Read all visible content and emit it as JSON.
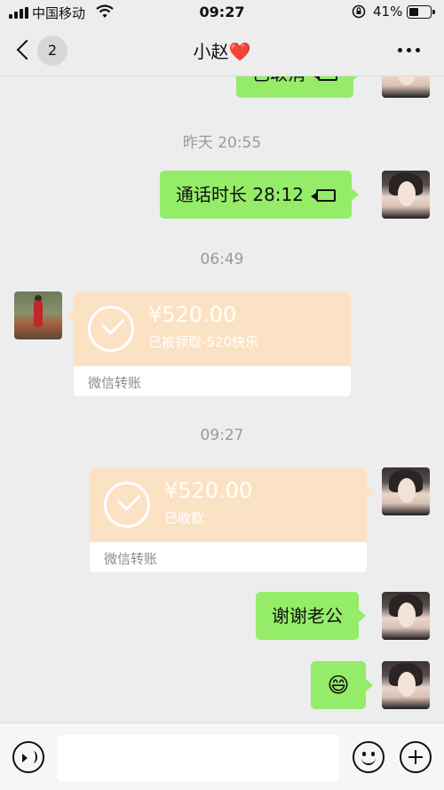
{
  "status_bar": {
    "carrier": "中国移动",
    "time": "09:27",
    "battery_percent": "41%",
    "battery_level": 0.41,
    "icons": [
      "signal-icon",
      "wifi-icon",
      "rotation-lock-icon",
      "battery-icon"
    ]
  },
  "nav": {
    "unread_count": "2",
    "title": "小赵",
    "title_emoji": "❤️",
    "icons": [
      "back-chevron-icon",
      "more-icon"
    ]
  },
  "messages": {
    "top_partial": {
      "text": "已取消",
      "icon": "video-call-icon"
    },
    "time_1": "昨天 20:55",
    "call": {
      "text": "通话时长 28:12",
      "icon": "video-call-icon"
    },
    "time_2": "06:49",
    "transfer_received": {
      "amount": "¥520.00",
      "note": "已被领取-520快乐",
      "footer": "微信转账",
      "icon": "check-circle-icon"
    },
    "time_3": "09:27",
    "transfer_sent": {
      "amount": "¥520.00",
      "note": "已收款",
      "footer": "微信转账",
      "icon": "check-circle-icon"
    },
    "thanks": {
      "text": "谢谢老公"
    },
    "emoji": {
      "text": "😄"
    }
  },
  "input_bar": {
    "placeholder": "",
    "icons": [
      "voice-icon",
      "emoji-icon",
      "plus-icon"
    ]
  },
  "colors": {
    "background": "#ededed",
    "own_bubble": "#95ec69",
    "transfer_card": "#fce2c4",
    "time_label": "#9a9a9a",
    "heart": "#e02a2a"
  }
}
